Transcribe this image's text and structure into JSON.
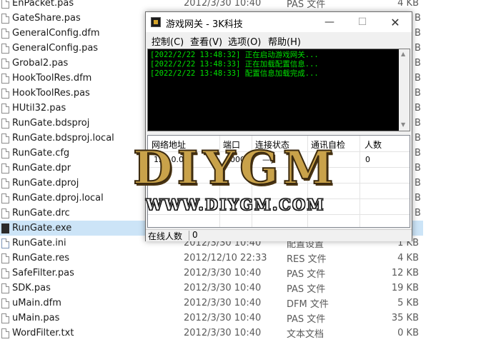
{
  "files": [
    {
      "name": "EnPacket.pas",
      "date": "2012/3/30 10:40",
      "type": "PAS 文件",
      "size": "4 KB",
      "icon": "pas-file-icon"
    },
    {
      "name": "GateShare.pas",
      "date": "",
      "type": "",
      "size": "",
      "icon": "pas-file-icon"
    },
    {
      "name": "GeneralConfig.dfm",
      "date": "",
      "type": "",
      "size": "",
      "icon": "dfm-file-icon"
    },
    {
      "name": "GeneralConfig.pas",
      "date": "",
      "type": "",
      "size": "",
      "icon": "pas-file-icon"
    },
    {
      "name": "Grobal2.pas",
      "date": "",
      "type": "",
      "size": "",
      "icon": "pas-file-icon"
    },
    {
      "name": "HookToolRes.dfm",
      "date": "",
      "type": "",
      "size": "",
      "icon": "dfm-file-icon"
    },
    {
      "name": "HookToolRes.pas",
      "date": "",
      "type": "",
      "size": "",
      "icon": "pas-file-icon"
    },
    {
      "name": "HUtil32.pas",
      "date": "",
      "type": "",
      "size": "",
      "icon": "pas-file-icon"
    },
    {
      "name": "RunGate.bdsproj",
      "date": "",
      "type": "",
      "size": "",
      "icon": "file-icon"
    },
    {
      "name": "RunGate.bdsproj.local",
      "date": "",
      "type": "",
      "size": "",
      "icon": "file-icon"
    },
    {
      "name": "RunGate.cfg",
      "date": "",
      "type": "",
      "size": "",
      "icon": "file-icon"
    },
    {
      "name": "RunGate.dpr",
      "date": "",
      "type": "",
      "size": "",
      "icon": "file-icon"
    },
    {
      "name": "RunGate.dproj",
      "date": "",
      "type": "",
      "size": "",
      "icon": "file-icon"
    },
    {
      "name": "RunGate.dproj.local",
      "date": "",
      "type": "",
      "size": "",
      "icon": "file-icon"
    },
    {
      "name": "RunGate.drc",
      "date": "",
      "type": "",
      "size": "",
      "icon": "file-icon"
    },
    {
      "name": "RunGate.exe",
      "date": "",
      "type": "",
      "size": "",
      "icon": "exe-file-icon"
    },
    {
      "name": "RunGate.ini",
      "date": "2012/3/30 10:40",
      "type": "配置设置",
      "size": "1 KB",
      "icon": "ini-file-icon"
    },
    {
      "name": "RunGate.res",
      "date": "2012/12/10 22:33",
      "type": "RES 文件",
      "size": "4 KB",
      "icon": "file-icon"
    },
    {
      "name": "SafeFilter.pas",
      "date": "2012/3/30 10:40",
      "type": "PAS 文件",
      "size": "12 KB",
      "icon": "pas-file-icon"
    },
    {
      "name": "SDK.pas",
      "date": "2012/3/30 10:40",
      "type": "PAS 文件",
      "size": "19 KB",
      "icon": "pas-file-icon"
    },
    {
      "name": "uMain.dfm",
      "date": "2012/3/30 10:40",
      "type": "DFM 文件",
      "size": "5 KB",
      "icon": "dfm-file-icon"
    },
    {
      "name": "uMain.pas",
      "date": "2012/3/30 10:40",
      "type": "PAS 文件",
      "size": "35 KB",
      "icon": "pas-file-icon"
    },
    {
      "name": "WordFilter.txt",
      "date": "2012/3/30 10:40",
      "type": "文本文档",
      "size": "0 KB",
      "icon": "txt-file-icon"
    }
  ],
  "right_edge_sizes": [
    "B",
    "B",
    "B",
    "B",
    "B",
    "B",
    "B",
    "B",
    "B",
    "B",
    "B",
    "B",
    "B",
    "B"
  ],
  "window": {
    "title": "游戏网关 - 3K科技",
    "minimize": "—",
    "maximize": "☐",
    "close": "✕",
    "menu": [
      "控制(C)",
      "查看(V)",
      "选项(O)",
      "帮助(H)"
    ],
    "log": [
      "[2022/2/22 13:48:32] 正在启动游戏网关...",
      "[2022/2/22 13:48:33] 正在加载配置信息...",
      "[2022/2/22 13:48:33] 配置信息加载完成..."
    ],
    "scroll_up": "▲",
    "scroll_down": "▼",
    "columns": [
      "网络地址",
      "端口",
      "连接状态",
      "通讯自检",
      "人数"
    ],
    "row": [
      "127.0.0.1",
      "5000",
      "—]",
      "[—",
      "0",
      "0"
    ],
    "status_label": "在线人数",
    "status_value": "0"
  },
  "watermark": {
    "logo": "DIYGM",
    "url": "WWW.DIYGM.COM"
  }
}
